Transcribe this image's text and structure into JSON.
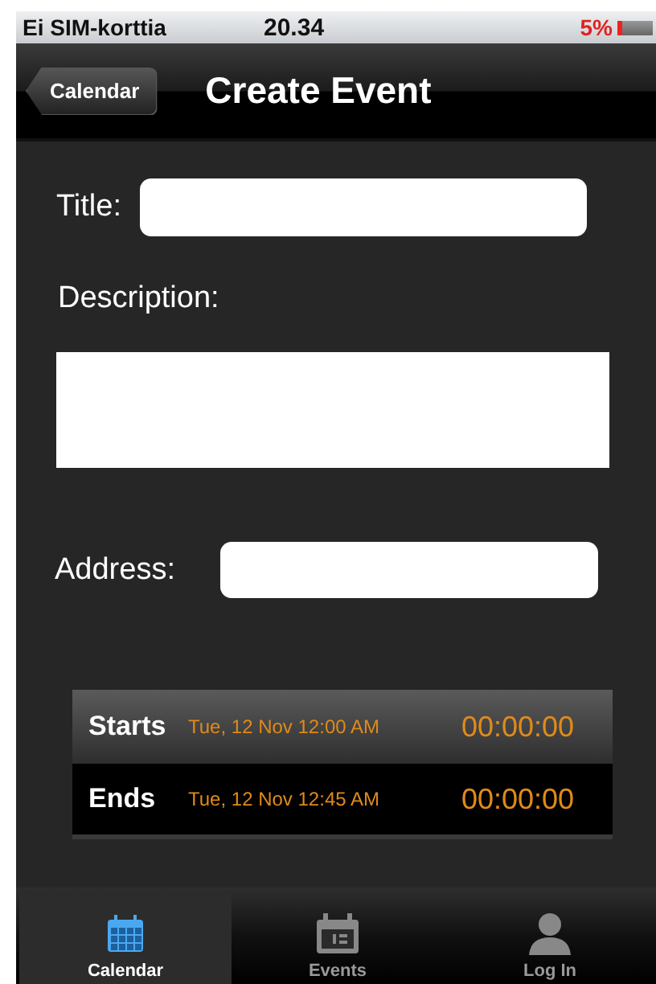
{
  "status_bar": {
    "carrier": "Ei SIM-korttia",
    "time": "20.34",
    "battery": "5%"
  },
  "nav_bar": {
    "back_button": "Calendar",
    "title": "Create Event"
  },
  "form": {
    "title_label": "Title:",
    "description_label": "Description:",
    "address_label": "Address:"
  },
  "schedule": [
    {
      "label": "Starts",
      "date": "Tue, 12 Nov 12:00 AM",
      "duration": "00:00:00"
    },
    {
      "label": "Ends",
      "date": "Tue, 12 Nov 12:45 AM",
      "duration": "00:00:00"
    }
  ],
  "tabs": [
    {
      "label": "Calendar",
      "kind": "calendar",
      "selected": true
    },
    {
      "label": "Events",
      "kind": "events",
      "selected": false
    },
    {
      "label": "Log In",
      "kind": "login",
      "selected": false
    }
  ]
}
